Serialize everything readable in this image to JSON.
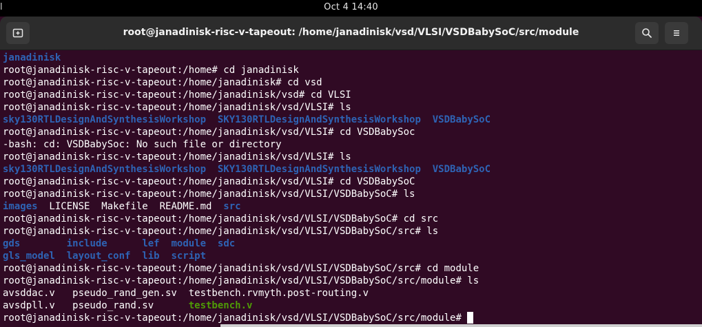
{
  "topbar": {
    "left_glyph": "l",
    "clock": "Oct 4  14:40"
  },
  "window": {
    "title": "root@janadinisk-risc-v-tapeout: /home/janadinisk/vsd/VLSI/VSDBabySoC/src/module",
    "new_tab_icon": "new-tab-icon",
    "search_icon": "search-icon",
    "menu_icon": "hamburger-menu-icon"
  },
  "colors": {
    "background": "#300a24",
    "directory": "#2e63b4",
    "executable": "#4e9a06",
    "text": "#ffffff"
  },
  "terminal": {
    "lines": [
      {
        "segments": [
          {
            "text": "janadinisk",
            "style": "dir"
          }
        ]
      },
      {
        "segments": [
          {
            "text": "root@janadinisk-risc-v-tapeout:/home# cd janadinisk",
            "style": "plain"
          }
        ]
      },
      {
        "segments": [
          {
            "text": "root@janadinisk-risc-v-tapeout:/home/janadinisk# cd vsd",
            "style": "plain"
          }
        ]
      },
      {
        "segments": [
          {
            "text": "root@janadinisk-risc-v-tapeout:/home/janadinisk/vsd# cd VLSI",
            "style": "plain"
          }
        ]
      },
      {
        "segments": [
          {
            "text": "root@janadinisk-risc-v-tapeout:/home/janadinisk/vsd/VLSI# ls",
            "style": "plain"
          }
        ]
      },
      {
        "segments": [
          {
            "text": "sky130RTLDesignAndSynthesisWorkshop",
            "style": "dir"
          },
          {
            "text": "  ",
            "style": "plain"
          },
          {
            "text": "SKY130RTLDesignAndSynthesisWorkshop",
            "style": "dir"
          },
          {
            "text": "  ",
            "style": "plain"
          },
          {
            "text": "VSDBabySoC",
            "style": "dir"
          }
        ]
      },
      {
        "segments": [
          {
            "text": "root@janadinisk-risc-v-tapeout:/home/janadinisk/vsd/VLSI# cd VSDBabySoc",
            "style": "plain"
          }
        ]
      },
      {
        "segments": [
          {
            "text": "-bash: cd: VSDBabySoc: No such file or directory",
            "style": "plain"
          }
        ]
      },
      {
        "segments": [
          {
            "text": "root@janadinisk-risc-v-tapeout:/home/janadinisk/vsd/VLSI# ls",
            "style": "plain"
          }
        ]
      },
      {
        "segments": [
          {
            "text": "sky130RTLDesignAndSynthesisWorkshop",
            "style": "dir"
          },
          {
            "text": "  ",
            "style": "plain"
          },
          {
            "text": "SKY130RTLDesignAndSynthesisWorkshop",
            "style": "dir"
          },
          {
            "text": "  ",
            "style": "plain"
          },
          {
            "text": "VSDBabySoC",
            "style": "dir"
          }
        ]
      },
      {
        "segments": [
          {
            "text": "root@janadinisk-risc-v-tapeout:/home/janadinisk/vsd/VLSI# cd VSDBabySoC",
            "style": "plain"
          }
        ]
      },
      {
        "segments": [
          {
            "text": "root@janadinisk-risc-v-tapeout:/home/janadinisk/vsd/VLSI/VSDBabySoC# ls",
            "style": "plain"
          }
        ]
      },
      {
        "segments": [
          {
            "text": "images",
            "style": "dir"
          },
          {
            "text": "  LICENSE  Makefile  README.md  ",
            "style": "plain"
          },
          {
            "text": "src",
            "style": "dir"
          }
        ]
      },
      {
        "segments": [
          {
            "text": "root@janadinisk-risc-v-tapeout:/home/janadinisk/vsd/VLSI/VSDBabySoC# cd src",
            "style": "plain"
          }
        ]
      },
      {
        "segments": [
          {
            "text": "root@janadinisk-risc-v-tapeout:/home/janadinisk/vsd/VLSI/VSDBabySoC/src# ls",
            "style": "plain"
          }
        ]
      },
      {
        "segments": [
          {
            "text": "gds",
            "style": "dir"
          },
          {
            "text": "        ",
            "style": "plain"
          },
          {
            "text": "include",
            "style": "dir"
          },
          {
            "text": "      ",
            "style": "plain"
          },
          {
            "text": "lef",
            "style": "dir"
          },
          {
            "text": "  ",
            "style": "plain"
          },
          {
            "text": "module",
            "style": "dir"
          },
          {
            "text": "  ",
            "style": "plain"
          },
          {
            "text": "sdc",
            "style": "dir"
          }
        ]
      },
      {
        "segments": [
          {
            "text": "gls_model",
            "style": "dir"
          },
          {
            "text": "  ",
            "style": "plain"
          },
          {
            "text": "layout_conf",
            "style": "dir"
          },
          {
            "text": "  ",
            "style": "plain"
          },
          {
            "text": "lib",
            "style": "dir"
          },
          {
            "text": "  ",
            "style": "plain"
          },
          {
            "text": "script",
            "style": "dir"
          }
        ]
      },
      {
        "segments": [
          {
            "text": "root@janadinisk-risc-v-tapeout:/home/janadinisk/vsd/VLSI/VSDBabySoC/src# cd module",
            "style": "plain"
          }
        ]
      },
      {
        "segments": [
          {
            "text": "root@janadinisk-risc-v-tapeout:/home/janadinisk/vsd/VLSI/VSDBabySoC/src/module# ls",
            "style": "plain"
          }
        ]
      },
      {
        "segments": [
          {
            "text": "avsddac.v   pseudo_rand_gen.sv  testbench.rvmyth.post-routing.v",
            "style": "plain"
          }
        ]
      },
      {
        "segments": [
          {
            "text": "avsdpll.v   pseudo_rand.sv      ",
            "style": "plain"
          },
          {
            "text": "testbench.v",
            "style": "exec"
          }
        ]
      },
      {
        "segments": [
          {
            "text": "root@janadinisk-risc-v-tapeout:/home/janadinisk/vsd/VLSI/VSDBabySoC/src/module# ",
            "style": "plain"
          }
        ],
        "cursor": true
      }
    ]
  }
}
